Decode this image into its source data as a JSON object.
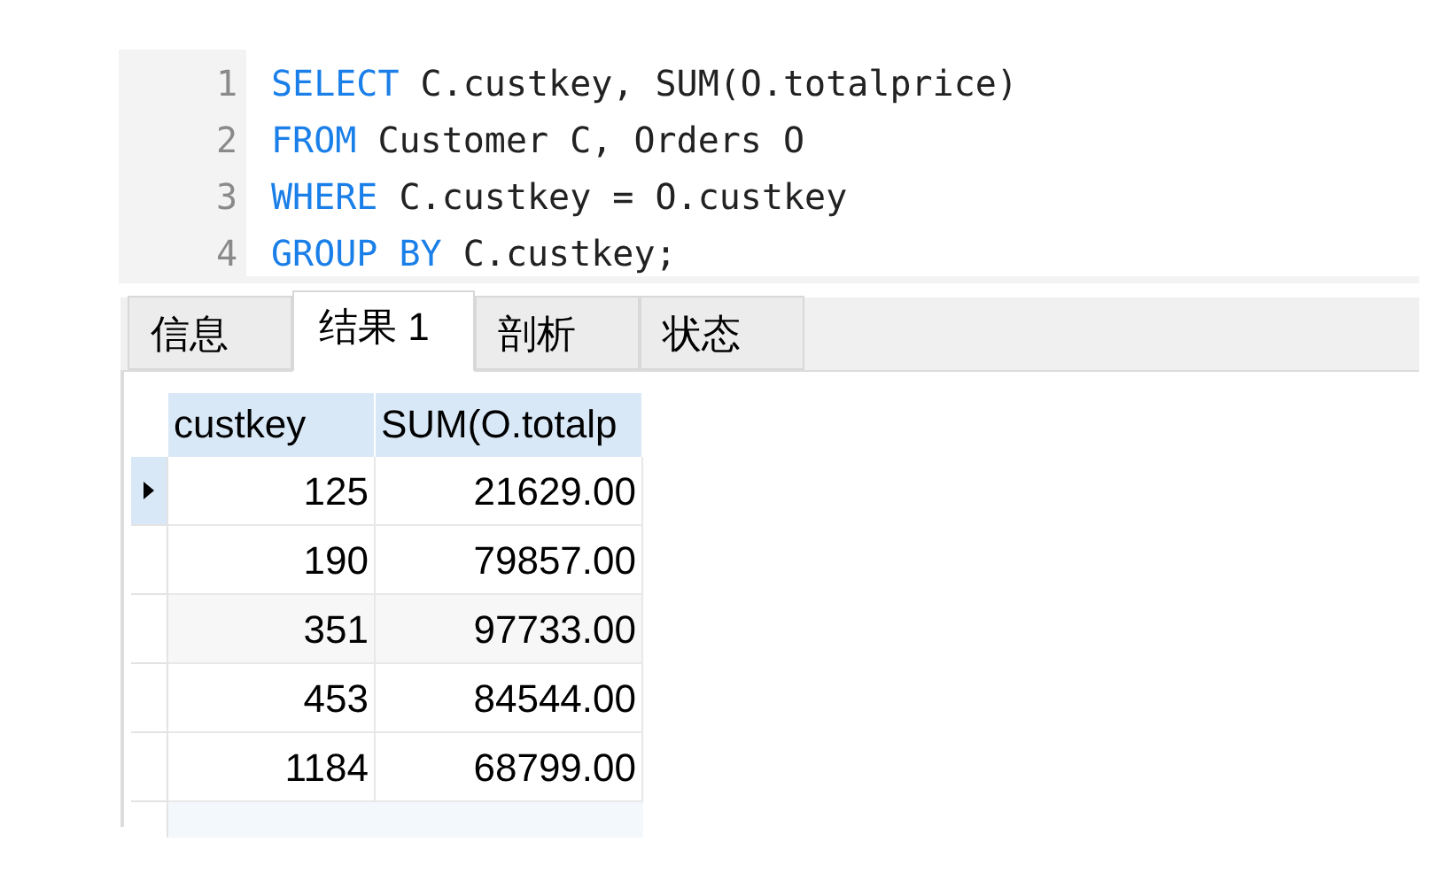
{
  "editor": {
    "lines": [
      {
        "number": "1",
        "tokens": [
          {
            "kind": "keyword",
            "text": "SELECT"
          },
          {
            "kind": "plain",
            "text": " C.custkey, SUM(O.totalprice)"
          }
        ]
      },
      {
        "number": "2",
        "tokens": [
          {
            "kind": "keyword",
            "text": "FROM"
          },
          {
            "kind": "plain",
            "text": " Customer C, Orders O"
          }
        ]
      },
      {
        "number": "3",
        "tokens": [
          {
            "kind": "keyword",
            "text": "WHERE"
          },
          {
            "kind": "plain",
            "text": " C.custkey = O.custkey"
          }
        ]
      },
      {
        "number": "4",
        "tokens": [
          {
            "kind": "keyword",
            "text": "GROUP BY"
          },
          {
            "kind": "plain",
            "text": " C.custkey;"
          }
        ]
      }
    ]
  },
  "tabs": [
    {
      "label": "信息",
      "selected": false
    },
    {
      "label": "结果 1",
      "selected": true
    },
    {
      "label": "剖析",
      "selected": false
    },
    {
      "label": "状态",
      "selected": false
    }
  ],
  "table": {
    "columns": [
      "custkey",
      "SUM(O.totalp"
    ],
    "rows": [
      {
        "selected": true,
        "cells": [
          "125",
          "21629.00"
        ]
      },
      {
        "selected": false,
        "cells": [
          "190",
          "79857.00"
        ]
      },
      {
        "selected": false,
        "cells": [
          "351",
          "97733.00"
        ]
      },
      {
        "selected": false,
        "cells": [
          "453",
          "84544.00"
        ]
      },
      {
        "selected": false,
        "cells": [
          "1184",
          "68799.00"
        ]
      }
    ]
  }
}
